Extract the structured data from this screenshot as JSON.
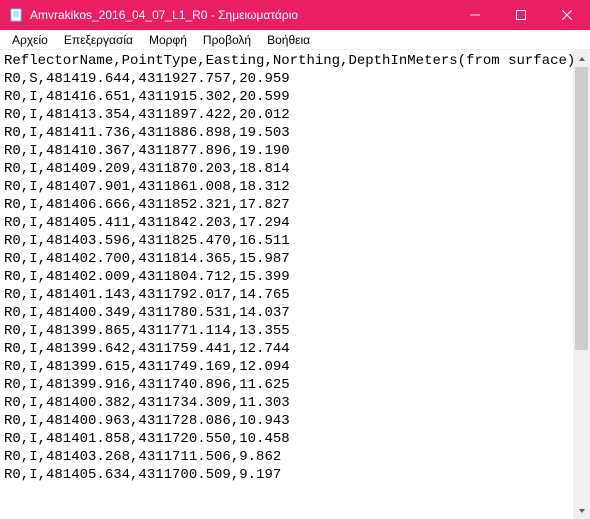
{
  "window": {
    "title": "Amvrakikos_2016_04_07_L1_R0 - Σημειωματάριο"
  },
  "menu": {
    "file": "Αρχείο",
    "edit": "Επεξεργασία",
    "format": "Μορφή",
    "view": "Προβολή",
    "help": "Βοήθεια"
  },
  "editor": {
    "header": "ReflectorName,PointType,Easting,Northing,DepthInMeters(from surface)",
    "rows": [
      "R0,S,481419.644,4311927.757,20.959",
      "R0,I,481416.651,4311915.302,20.599",
      "R0,I,481413.354,4311897.422,20.012",
      "R0,I,481411.736,4311886.898,19.503",
      "R0,I,481410.367,4311877.896,19.190",
      "R0,I,481409.209,4311870.203,18.814",
      "R0,I,481407.901,4311861.008,18.312",
      "R0,I,481406.666,4311852.321,17.827",
      "R0,I,481405.411,4311842.203,17.294",
      "R0,I,481403.596,4311825.470,16.511",
      "R0,I,481402.700,4311814.365,15.987",
      "R0,I,481402.009,4311804.712,15.399",
      "R0,I,481401.143,4311792.017,14.765",
      "R0,I,481400.349,4311780.531,14.037",
      "R0,I,481399.865,4311771.114,13.355",
      "R0,I,481399.642,4311759.441,12.744",
      "R0,I,481399.615,4311749.169,12.094",
      "R0,I,481399.916,4311740.896,11.625",
      "R0,I,481400.382,4311734.309,11.303",
      "R0,I,481400.963,4311728.086,10.943",
      "R0,I,481401.858,4311720.550,10.458",
      "R0,I,481403.268,4311711.506,9.862",
      "R0,I,481405.634,4311700.509,9.197"
    ]
  }
}
